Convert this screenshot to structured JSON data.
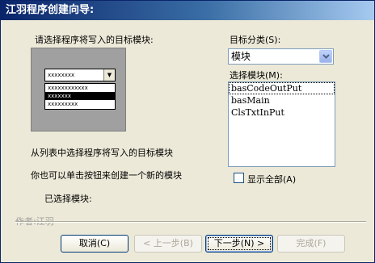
{
  "window": {
    "title": "江羽程序创建向导:"
  },
  "instruction": "请选择程序将写入的目标模块:",
  "preview": {
    "combo_text": "xxxxxxxx",
    "dropdown_glyph": "▼",
    "list_items": [
      "xxxxxxxxxxxx",
      "xxxxxxx",
      "xxxxxxxxx"
    ],
    "selected_index": 1
  },
  "category": {
    "label": "目标分类(S):",
    "value": "模块",
    "dropdown_icon": "chevron-down-icon"
  },
  "module_list": {
    "label": "选择模块(M):",
    "items": [
      "basCodeOutPut",
      "basMain",
      "ClsTxtInPut"
    ]
  },
  "help": {
    "line1": "从列表中选择程序将写入的目标模块",
    "line2": "你也可以单击按钮来创建一个新的模块",
    "selected_module_label": "已选择模块:"
  },
  "show_all": {
    "label": "显示全部(A)",
    "checked": false
  },
  "author": "作者:江羽",
  "buttons": {
    "cancel": "取消(C)",
    "back": "< 上一步(B)",
    "next": "下一步(N) >",
    "finish": "完成(F)"
  }
}
